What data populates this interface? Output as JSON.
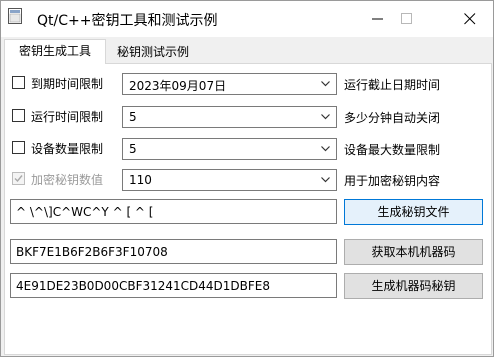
{
  "window": {
    "title": "Qt/C++密钥工具和测试示例"
  },
  "tabs": [
    {
      "label": "密钥生成工具",
      "active": true
    },
    {
      "label": "秘钥测试示例",
      "active": false
    }
  ],
  "rows": [
    {
      "check_label": "到期时间限制",
      "checked": false,
      "enabled": true,
      "combo_value": "2023年09月07日",
      "desc": "运行截止日期时间"
    },
    {
      "check_label": "运行时间限制",
      "checked": false,
      "enabled": true,
      "combo_value": "5",
      "desc": "多少分钟自动关闭"
    },
    {
      "check_label": "设备数量限制",
      "checked": false,
      "enabled": true,
      "combo_value": "5",
      "desc": "设备最大数量限制"
    },
    {
      "check_label": "加密秘钥数值",
      "checked": true,
      "enabled": false,
      "combo_value": "110",
      "desc": "用于加密秘钥内容"
    }
  ],
  "actions": [
    {
      "field_value": "^ \\^\\]C^WC^Y ^ [ ^ [",
      "button_label": "生成秘钥文件"
    },
    {
      "field_value": "BKF7E1B6F2B6F3F10708",
      "button_label": "获取本机机器码"
    },
    {
      "field_value": "4E91DE23B0D00CBF31241CD44D1DBFE8",
      "button_label": "生成机器码秘钥"
    }
  ],
  "icons": {
    "app": "app-window-icon",
    "minimize": "minimize-icon",
    "maximize": "maximize-icon",
    "close": "close-icon",
    "dropdown": "chevron-down-icon",
    "check": "check-icon"
  }
}
